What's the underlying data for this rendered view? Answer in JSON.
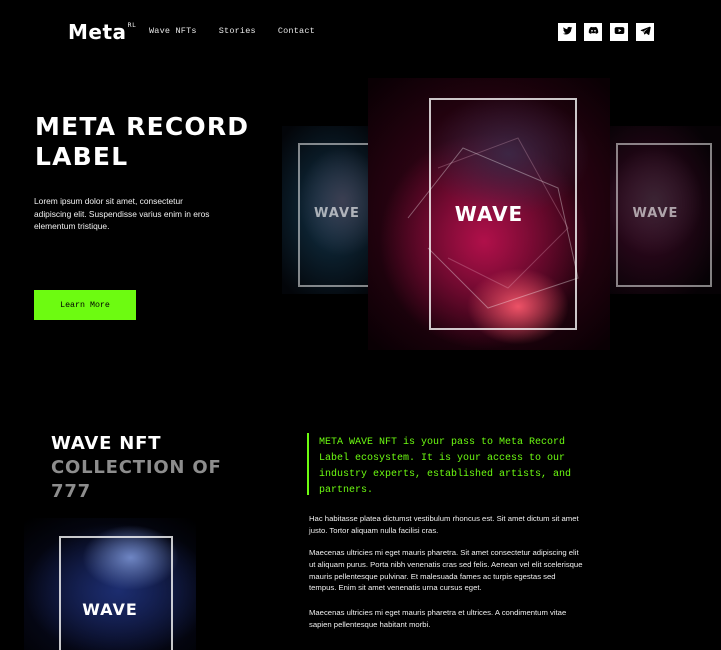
{
  "header": {
    "logo_text": "Meta",
    "logo_sup": "RL",
    "nav": [
      "Wave NFTs",
      "Stories",
      "Contact"
    ],
    "socials": [
      "twitter-icon",
      "discord-icon",
      "youtube-icon",
      "telegram-icon"
    ]
  },
  "hero": {
    "title_line1": "META RECORD",
    "title_line2": "LABEL",
    "description": "Lorem ipsum dolor sit amet, consectetur adipiscing elit. Suspendisse varius enim in eros elementum tristique.",
    "cta": "Learn More"
  },
  "cards": {
    "main": "WAVE",
    "left": "WAVE",
    "right": "WAVE",
    "small": "WAVE"
  },
  "collection": {
    "title_line1": "WAVE NFT",
    "title_line2": "COLLECTION OF 777",
    "quote": "META WAVE NFT is your pass to Meta Record Label ecosystem. It is your access to our industry experts, established artists, and partners.",
    "para1": "Hac habitasse platea dictumst vestibulum rhoncus est. Sit amet dictum sit amet justo. Tortor aliquam nulla facilisi cras.",
    "para2": "Maecenas ultricies mi eget mauris pharetra. Sit amet consectetur adipiscing elit ut aliquam purus. Porta nibh venenatis cras sed felis. Aenean vel elit scelerisque mauris pellentesque pulvinar. Et malesuada fames ac turpis egestas sed tempus. Enim sit amet venenatis urna cursus eget.",
    "para3": "Maecenas ultricies mi eget mauris pharetra et ultrices. A condimentum vitae sapien pellentesque habitant morbi."
  },
  "colors": {
    "background": "#000000",
    "accent": "#6dfb11",
    "muted_heading": "#8d8d8d"
  }
}
